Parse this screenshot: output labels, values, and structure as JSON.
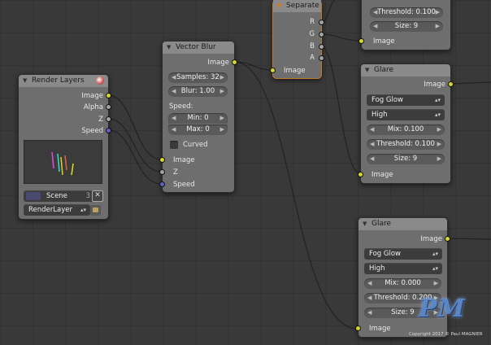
{
  "nodes": {
    "separate": {
      "title": "Separate",
      "outputs": [
        "R",
        "G",
        "B",
        "A"
      ],
      "input": "Image"
    },
    "glare_top": {
      "threshold": "Threshold: 0.100",
      "size": "Size: 9",
      "input": "Image"
    },
    "render_layers": {
      "title": "Render Layers",
      "outputs": [
        "Image",
        "Alpha",
        "Z",
        "Speed"
      ],
      "scene": "Scene",
      "scene_count": "3",
      "layer": "RenderLayer"
    },
    "vector_blur": {
      "title": "Vector Blur",
      "output": "Image",
      "samples": "Samples: 32",
      "blur": "Blur: 1.00",
      "speed_label": "Speed:",
      "min": "Min: 0",
      "max": "Max: 0",
      "curved": "Curved",
      "inputs": [
        "Image",
        "Z",
        "Speed"
      ]
    },
    "glare_mid": {
      "title": "Glare",
      "output": "Image",
      "type": "Fog Glow",
      "quality": "High",
      "mix": "Mix: 0.100",
      "threshold": "Threshold: 0.100",
      "size": "Size: 9",
      "input": "Image"
    },
    "glare_bot": {
      "title": "Glare",
      "output": "Image",
      "type": "Fog Glow",
      "quality": "High",
      "mix": "Mix: 0.000",
      "threshold": "Threshold: 0.200",
      "size": "Size: 9",
      "input": "Image"
    }
  },
  "watermark": {
    "logo": "PM",
    "copyright": "Copyright 2017 © Paul MAGNIER"
  },
  "colors": {
    "socket_image": "#d6d72a",
    "socket_value": "#a3a3a3",
    "socket_vector": "#6161c6",
    "selected": "#c07a2a"
  }
}
